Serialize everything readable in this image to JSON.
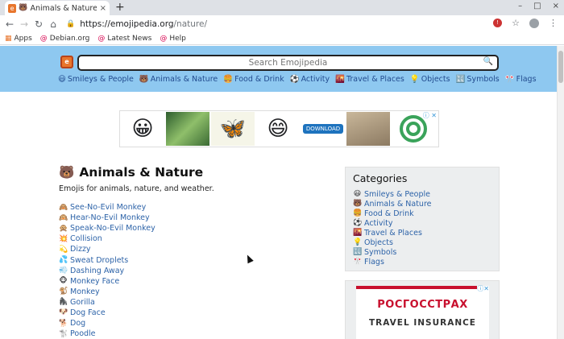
{
  "browser": {
    "tab_title": "Animals & Nature Emoji",
    "tab_close": "×",
    "new_tab": "+",
    "window_controls": [
      "–",
      "□",
      "×"
    ],
    "url_host": "https://emojipedia.org",
    "url_path": "/nature/",
    "bookmarks": [
      {
        "label": "Apps",
        "icon": "apps-grid-icon"
      },
      {
        "label": "Debian.org",
        "icon": "debian-swirl-icon"
      },
      {
        "label": "Latest News",
        "icon": "debian-swirl-icon"
      },
      {
        "label": "Help",
        "icon": "debian-swirl-icon"
      }
    ]
  },
  "site": {
    "search_placeholder": "Search Emojipedia",
    "nav": [
      {
        "emoji": "😃",
        "label": "Smileys & People"
      },
      {
        "emoji": "🐻",
        "label": "Animals & Nature"
      },
      {
        "emoji": "🍔",
        "label": "Food & Drink"
      },
      {
        "emoji": "⚽",
        "label": "Activity"
      },
      {
        "emoji": "🌇",
        "label": "Travel & Places"
      },
      {
        "emoji": "💡",
        "label": "Objects"
      },
      {
        "emoji": "🔣",
        "label": "Symbols"
      },
      {
        "emoji": "🎌",
        "label": "Flags"
      }
    ]
  },
  "ad_banner": {
    "download_label": "DOWNLOAD",
    "adchoices": "ⓘ ✕"
  },
  "main": {
    "title_emoji": "🐻",
    "title": "Animals & Nature",
    "description": "Emojis for animals, nature, and weather.",
    "emojis": [
      {
        "emoji": "🙈",
        "label": "See-No-Evil Monkey"
      },
      {
        "emoji": "🙉",
        "label": "Hear-No-Evil Monkey"
      },
      {
        "emoji": "🙊",
        "label": "Speak-No-Evil Monkey"
      },
      {
        "emoji": "💥",
        "label": "Collision"
      },
      {
        "emoji": "💫",
        "label": "Dizzy"
      },
      {
        "emoji": "💦",
        "label": "Sweat Droplets"
      },
      {
        "emoji": "💨",
        "label": "Dashing Away"
      },
      {
        "emoji": "🐵",
        "label": "Monkey Face"
      },
      {
        "emoji": "🐒",
        "label": "Monkey"
      },
      {
        "emoji": "🦍",
        "label": "Gorilla"
      },
      {
        "emoji": "🐶",
        "label": "Dog Face"
      },
      {
        "emoji": "🐕",
        "label": "Dog"
      },
      {
        "emoji": "🐩",
        "label": "Poodle"
      }
    ]
  },
  "sidebar": {
    "heading": "Categories",
    "categories": [
      {
        "emoji": "😃",
        "label": "Smileys & People"
      },
      {
        "emoji": "🐻",
        "label": "Animals & Nature"
      },
      {
        "emoji": "🍔",
        "label": "Food & Drink"
      },
      {
        "emoji": "⚽",
        "label": "Activity"
      },
      {
        "emoji": "🌇",
        "label": "Travel & Places"
      },
      {
        "emoji": "💡",
        "label": "Objects"
      },
      {
        "emoji": "🔣",
        "label": "Symbols"
      },
      {
        "emoji": "🎌",
        "label": "Flags"
      }
    ],
    "ad": {
      "brand": "РОСГОССТРАХ",
      "tagline": "TRAVEL INSURANCE",
      "adchoices": "ⓘ✕"
    }
  },
  "colors": {
    "header_bg": "#8ec8f0",
    "link": "#2d63a8",
    "sidebar_bg": "#eceeef"
  }
}
